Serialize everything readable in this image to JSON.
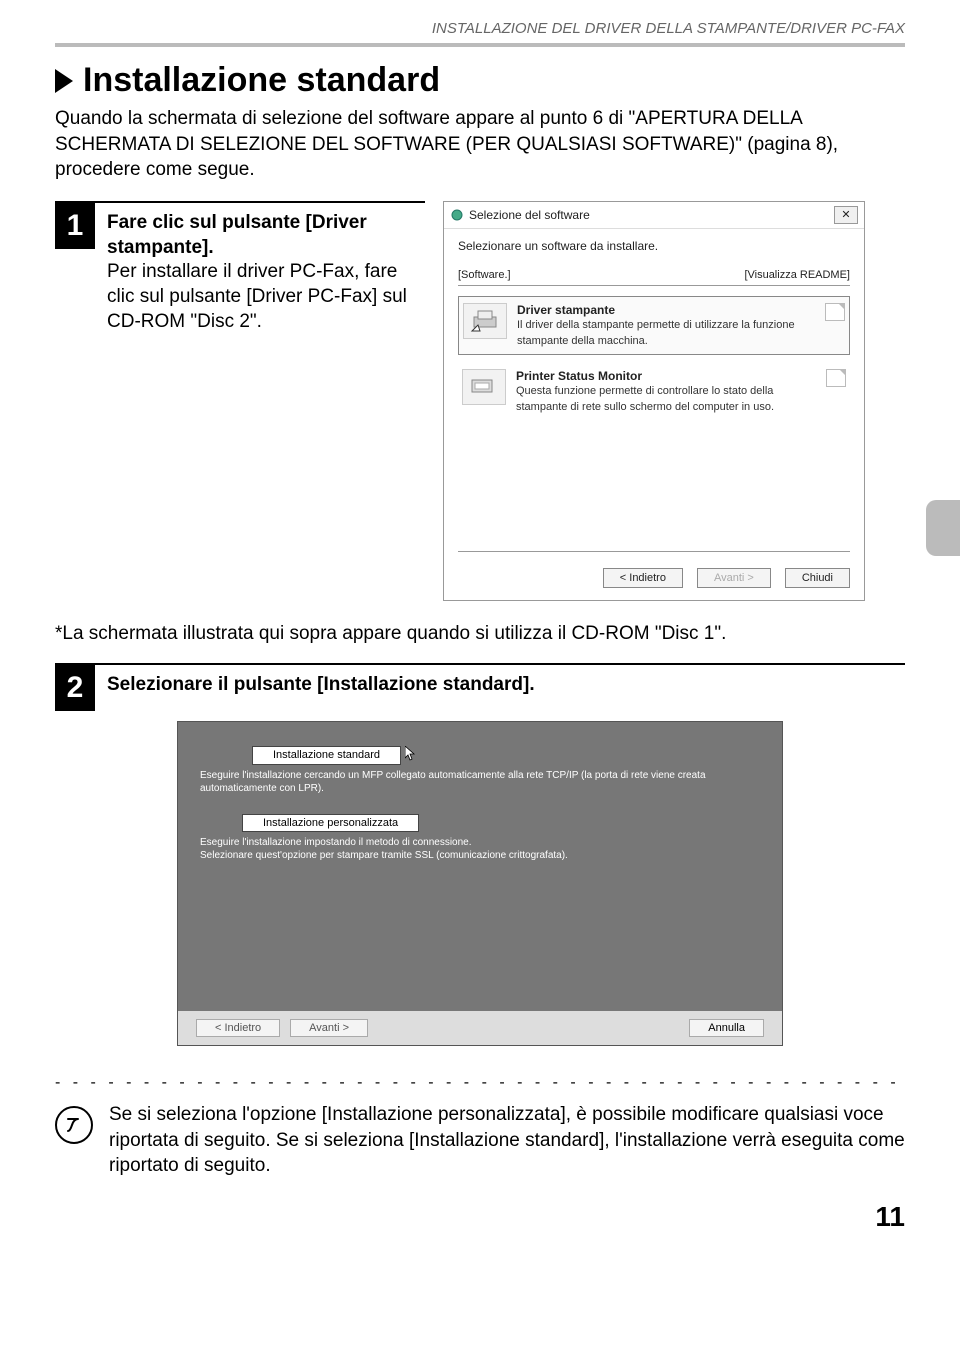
{
  "header": {
    "section_title": "INSTALLAZIONE DEL DRIVER DELLA STAMPANTE/DRIVER PC-FAX"
  },
  "heading": "Installazione standard",
  "intro": "Quando la schermata di selezione del software appare al punto 6 di \"APERTURA DELLA SCHERMATA DI SELEZIONE DEL SOFTWARE (PER QUALSIASI SOFTWARE)\" (pagina 8), procedere come segue.",
  "step1": {
    "number": "1",
    "title": "Fare clic sul pulsante [Driver stampante].",
    "desc": "Per installare il driver PC-Fax, fare clic sul pulsante [Driver PC-Fax] sul CD-ROM \"Disc 2\"."
  },
  "dialog1": {
    "title": "Selezione del software",
    "intro": "Selezionare un software da installare.",
    "left_label": "[Software.]",
    "right_link": "[Visualizza README]",
    "items": [
      {
        "title": "Driver stampante",
        "desc": "Il driver della stampante permette di utilizzare la funzione stampante della macchina."
      },
      {
        "title": "Printer Status Monitor",
        "desc": "Questa funzione permette di controllare lo stato della stampante di rete sullo schermo del computer in uso."
      }
    ],
    "buttons": {
      "back": "< Indietro",
      "next": "Avanti >",
      "close": "Chiudi"
    }
  },
  "note": "*La schermata illustrata qui sopra appare quando si utilizza il CD-ROM \"Disc 1\".",
  "step2": {
    "number": "2",
    "title": "Selezionare il pulsante [Installazione standard]."
  },
  "dialog2": {
    "opt1_btn": "Installazione standard",
    "opt1_desc": "Eseguire l'installazione cercando un MFP collegato automaticamente alla rete TCP/IP (la porta di rete viene creata automaticamente con LPR).",
    "opt2_btn": "Installazione personalizzata",
    "opt2_desc1": "Eseguire l'installazione impostando il metodo di connessione.",
    "opt2_desc2": "Selezionare quest'opzione per stampare tramite SSL (comunicazione crittografata).",
    "buttons": {
      "back": "< Indietro",
      "next": "Avanti >",
      "cancel": "Annulla"
    }
  },
  "footnote": "Se si seleziona l'opzione [Installazione personalizzata], è possibile modificare qualsiasi voce riportata di seguito. Se si seleziona [Installazione standard], l'installazione verrà eseguita come riportato di seguito.",
  "page_number": "11"
}
